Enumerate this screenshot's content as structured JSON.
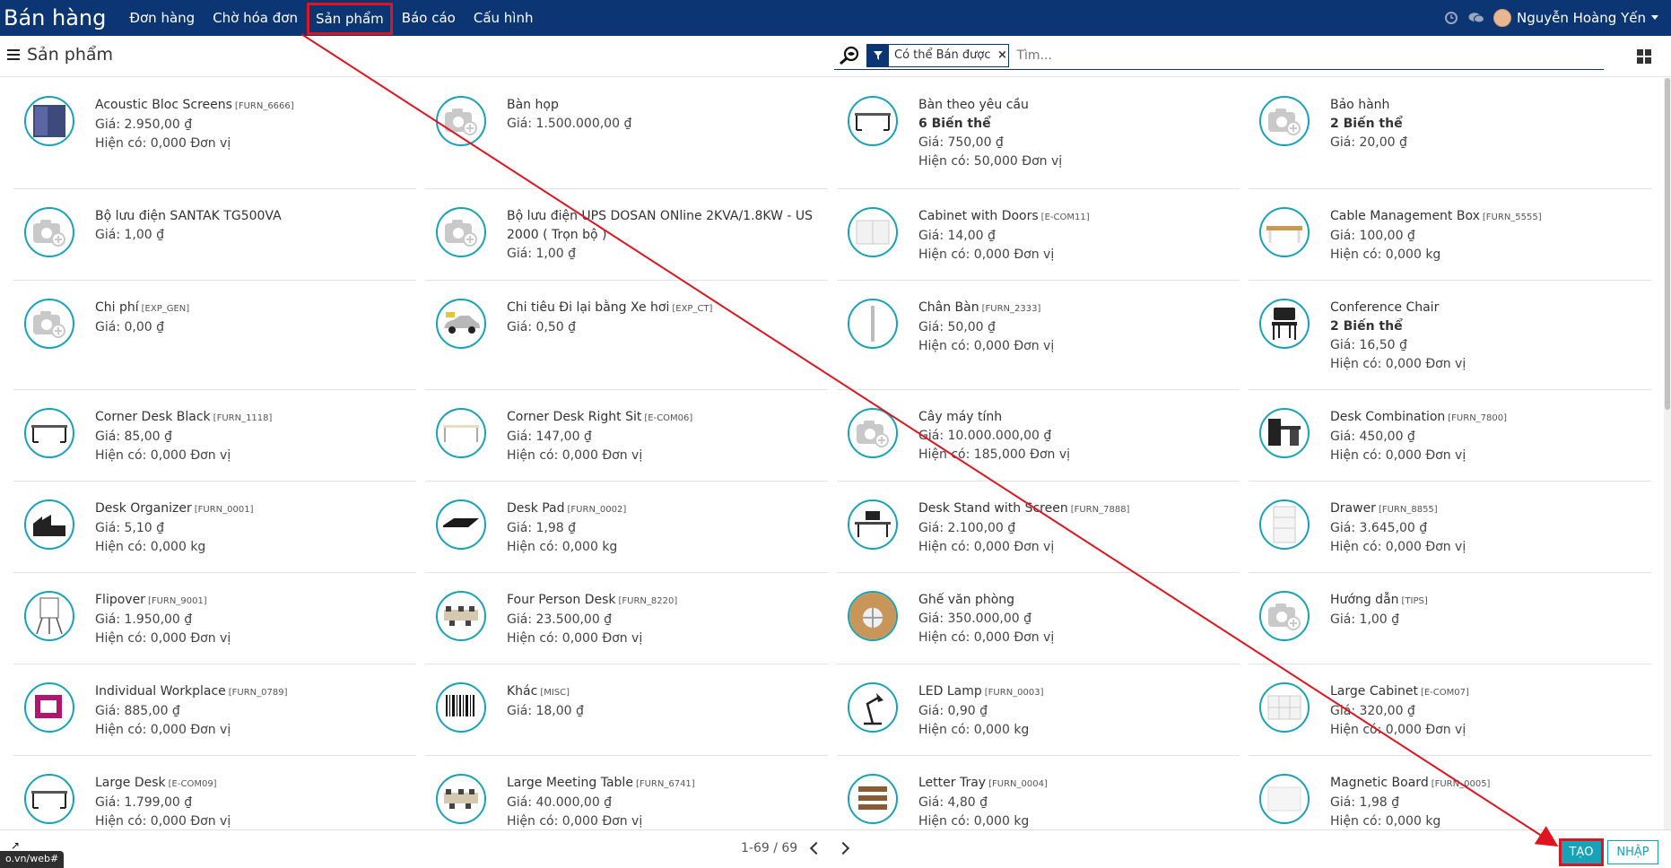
{
  "navbar": {
    "app_title": "Bán hàng",
    "menu": [
      "Đơn hàng",
      "Chờ hóa đơn",
      "Sản phẩm",
      "Báo cáo",
      "Cấu hình"
    ],
    "active_index": 2,
    "user_name": "Nguyễn Hoàng Yến"
  },
  "control": {
    "breadcrumb": "Sản phẩm",
    "facet_label": "Có thể Bán được",
    "facet_close": "×",
    "search_placeholder": "Tìm..."
  },
  "products": [
    {
      "name": "Acoustic Bloc Screens",
      "ref": "[FURN_6666]",
      "variants": "",
      "price": "Giá: 2.950,00 ₫",
      "stock": "Hiện có: 0,000 Đơn vị",
      "img": "screen"
    },
    {
      "name": "Bàn họp",
      "ref": "",
      "variants": "",
      "price": "Giá: 1.500.000,00 ₫",
      "stock": "",
      "img": "camera"
    },
    {
      "name": "Bàn theo yêu cầu",
      "ref": "",
      "variants": "6 Biến thể",
      "price": "Giá: 750,00 ₫",
      "stock": "Hiện có: 50,000 Đơn vị",
      "img": "desk"
    },
    {
      "name": "Bảo hành",
      "ref": "",
      "variants": "2 Biến thể",
      "price": "Giá: 20,00 ₫",
      "stock": "",
      "img": "camera"
    },
    {
      "name": "Bộ lưu điện SANTAK TG500VA",
      "ref": "",
      "variants": "",
      "price": "Giá: 1,00 ₫",
      "stock": "",
      "img": "camera"
    },
    {
      "name": "Bộ lưu điện UPS DOSAN ONline 2KVA/1.8KW - US 2000 ( Trọn bộ )",
      "ref": "",
      "variants": "",
      "price": "Giá: 1,00 ₫",
      "stock": "",
      "img": "camera"
    },
    {
      "name": "Cabinet with Doors",
      "ref": "[E-COM11]",
      "variants": "",
      "price": "Giá: 14,00 ₫",
      "stock": "Hiện có: 0,000 Đơn vị",
      "img": "cabinet"
    },
    {
      "name": "Cable Management Box",
      "ref": "[FURN_5555]",
      "variants": "",
      "price": "Giá: 100,00 ₫",
      "stock": "Hiện có: 0,000 kg",
      "img": "table"
    },
    {
      "name": "Chi phí",
      "ref": "[EXP_GEN]",
      "variants": "",
      "price": "Giá: 0,00 ₫",
      "stock": "",
      "img": "camera"
    },
    {
      "name": "Chi tiêu Đi lại bằng Xe hơi",
      "ref": "[EXP_CT]",
      "variants": "",
      "price": "Giá: 0,50 ₫",
      "stock": "",
      "img": "car"
    },
    {
      "name": "Chân Bàn",
      "ref": "[FURN_2333]",
      "variants": "",
      "price": "Giá: 50,00 ₫",
      "stock": "Hiện có: 0,000 Đơn vị",
      "img": "leg"
    },
    {
      "name": "Conference Chair",
      "ref": "",
      "variants": "2 Biến thể",
      "price": "Giá: 16,50 ₫",
      "stock": "Hiện có: 0,000 Đơn vị",
      "img": "chair"
    },
    {
      "name": "Corner Desk Black",
      "ref": "[FURN_1118]",
      "variants": "",
      "price": "Giá: 85,00 ₫",
      "stock": "Hiện có: 0,000 Đơn vị",
      "img": "desk"
    },
    {
      "name": "Corner Desk Right Sit",
      "ref": "[E-COM06]",
      "variants": "",
      "price": "Giá: 147,00 ₫",
      "stock": "Hiện có: 0,000 Đơn vị",
      "img": "desk-light"
    },
    {
      "name": "Cây máy tính",
      "ref": "",
      "variants": "",
      "price": "Giá: 10.000.000,00 ₫",
      "stock": "Hiện có: 185,000 Đơn vị",
      "img": "camera"
    },
    {
      "name": "Desk Combination",
      "ref": "[FURN_7800]",
      "variants": "",
      "price": "Giá: 450,00 ₫",
      "stock": "Hiện có: 0,000 Đơn vị",
      "img": "combo"
    },
    {
      "name": "Desk Organizer",
      "ref": "[FURN_0001]",
      "variants": "",
      "price": "Giá: 5,10 ₫",
      "stock": "Hiện có: 0,000 kg",
      "img": "organizer"
    },
    {
      "name": "Desk Pad",
      "ref": "[FURN_0002]",
      "variants": "",
      "price": "Giá: 1,98 ₫",
      "stock": "Hiện có: 0,000 kg",
      "img": "pad"
    },
    {
      "name": "Desk Stand with Screen",
      "ref": "[FURN_7888]",
      "variants": "",
      "price": "Giá: 2.100,00 ₫",
      "stock": "Hiện có: 0,000 Đơn vị",
      "img": "stand"
    },
    {
      "name": "Drawer",
      "ref": "[FURN_8855]",
      "variants": "",
      "price": "Giá: 3.645,00 ₫",
      "stock": "Hiện có: 0,000 Đơn vị",
      "img": "drawer"
    },
    {
      "name": "Flipover",
      "ref": "[FURN_9001]",
      "variants": "",
      "price": "Giá: 1.950,00 ₫",
      "stock": "Hiện có: 0,000 Đơn vị",
      "img": "flip"
    },
    {
      "name": "Four Person Desk",
      "ref": "[FURN_8220]",
      "variants": "",
      "price": "Giá: 23.500,00 ₫",
      "stock": "Hiện có: 0,000 Đơn vị",
      "img": "office"
    },
    {
      "name": "Ghế văn phòng",
      "ref": "",
      "variants": "",
      "price": "Giá: 350.000,00 ₫",
      "stock": "Hiện có: 0,000 Đơn vị",
      "img": "wood"
    },
    {
      "name": "Hướng dẫn",
      "ref": "[TIPS]",
      "variants": "",
      "price": "Giá: 1,00 ₫",
      "stock": "",
      "img": "camera"
    },
    {
      "name": "Individual Workplace",
      "ref": "[FURN_0789]",
      "variants": "",
      "price": "Giá: 885,00 ₫",
      "stock": "Hiện có: 0,000 Đơn vị",
      "img": "booth"
    },
    {
      "name": "Khác",
      "ref": "[MISC]",
      "variants": "",
      "price": "Giá: 18,00 ₫",
      "stock": "",
      "img": "barcode"
    },
    {
      "name": "LED Lamp",
      "ref": "[FURN_0003]",
      "variants": "",
      "price": "Giá: 0,90 ₫",
      "stock": "Hiện có: 0,000 kg",
      "img": "lamp"
    },
    {
      "name": "Large Cabinet",
      "ref": "[E-COM07]",
      "variants": "",
      "price": "Giá: 320,00 ₫",
      "stock": "Hiện có: 0,000 Đơn vị",
      "img": "shelves"
    },
    {
      "name": "Large Desk",
      "ref": "[E-COM09]",
      "variants": "",
      "price": "Giá: 1.799,00 ₫",
      "stock": "Hiện có: 0,000 Đơn vị",
      "img": "desk"
    },
    {
      "name": "Large Meeting Table",
      "ref": "[FURN_6741]",
      "variants": "",
      "price": "Giá: 40.000,00 ₫",
      "stock": "Hiện có: 0,000 Đơn vị",
      "img": "office"
    },
    {
      "name": "Letter Tray",
      "ref": "[FURN_0004]",
      "variants": "",
      "price": "Giá: 4,80 ₫",
      "stock": "Hiện có: 0,000 kg",
      "img": "tray"
    },
    {
      "name": "Magnetic Board",
      "ref": "[FURN_0005]",
      "variants": "",
      "price": "Giá: 1,98 ₫",
      "stock": "Hiện có: 0,000 kg",
      "img": "board"
    }
  ],
  "pager": {
    "text": "1-69 / 69"
  },
  "buttons": {
    "create": "TẠO",
    "import": "NHẬP"
  },
  "status_url": "o.vn/web#"
}
